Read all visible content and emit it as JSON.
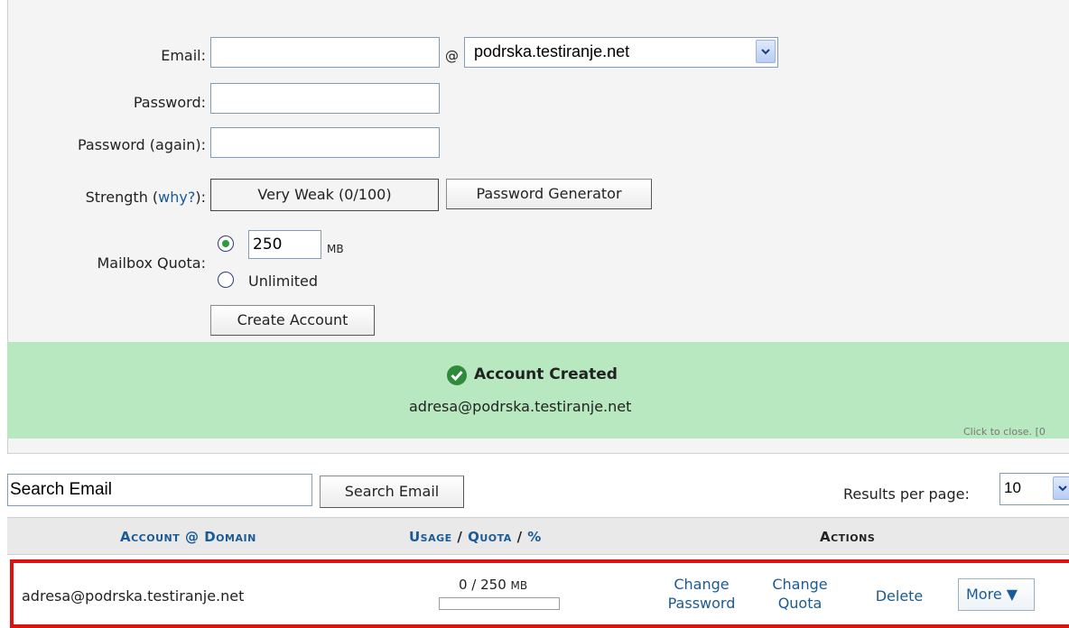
{
  "form": {
    "email_label": "Email:",
    "email_value": "",
    "at_sign": "@",
    "domain_selected": "podrska.testiranje.net",
    "password_label": "Password:",
    "password_again_label": "Password (again):",
    "strength_label_prefix": "Strength (",
    "strength_why_link": "why?",
    "strength_label_suffix": "):",
    "strength_value": "Very Weak (0/100)",
    "password_generator_button": "Password Generator",
    "quota_label": "Mailbox Quota:",
    "quota_value": "250",
    "quota_unit": "MB",
    "unlimited_label": "Unlimited",
    "create_button": "Create Account"
  },
  "banner": {
    "title": "Account Created",
    "address": "adresa@podrska.testiranje.net",
    "close_text": "Click to close. [0"
  },
  "search": {
    "input_value": "Search Email",
    "button_label": "Search Email",
    "results_label": "Results per page:",
    "results_value": "10"
  },
  "table": {
    "col_account": "Account",
    "col_at": "@",
    "col_domain": "Domain",
    "col_usage": "Usage",
    "col_slash1": "/",
    "col_quota": "Quota",
    "col_slash2": "/",
    "col_percent": "%",
    "col_actions": "Actions",
    "rows": [
      {
        "account": "adresa@podrska.testiranje.net",
        "usage": "0 / 250",
        "usage_unit": "MB",
        "usage_fraction": 0,
        "change_password_1": "Change",
        "change_password_2": "Password",
        "change_quota_1": "Change",
        "change_quota_2": "Quota",
        "delete": "Delete",
        "more": "More ▼"
      }
    ]
  },
  "colors": {
    "link": "#1a5a96",
    "banner_bg": "#b7e8bf",
    "highlight_border": "#e01010",
    "check_green": "#2e8b3a"
  }
}
